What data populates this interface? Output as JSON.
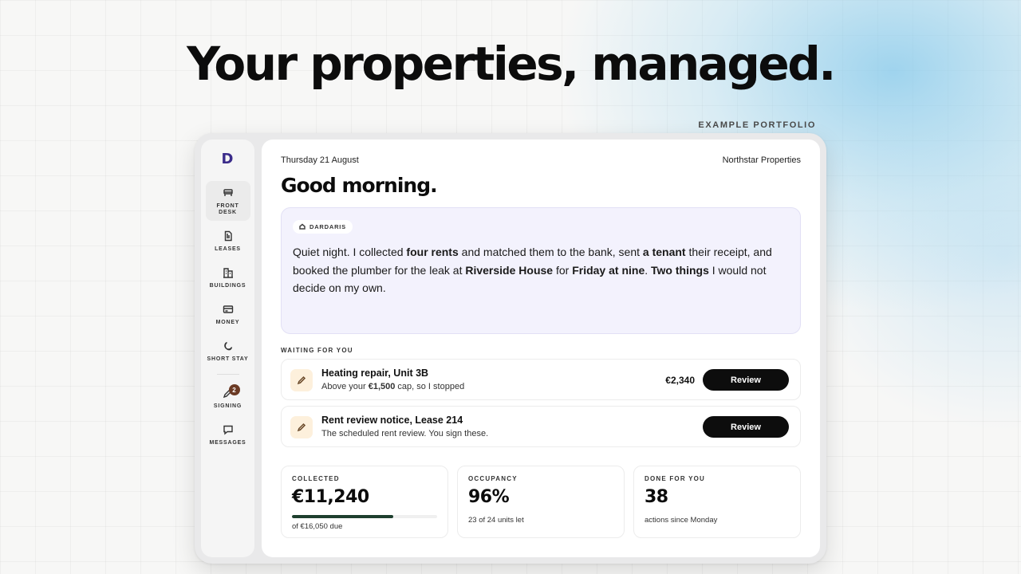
{
  "headline": "Your properties, managed.",
  "example_tag": "EXAMPLE PORTFOLIO",
  "sidebar": {
    "logo": "D",
    "items": [
      {
        "label": "FRONT DESK",
        "icon": "front-desk-icon",
        "active": true
      },
      {
        "label": "LEASES",
        "icon": "document-icon",
        "active": false
      },
      {
        "label": "BUILDINGS",
        "icon": "buildings-icon",
        "active": false
      },
      {
        "label": "MONEY",
        "icon": "card-icon",
        "active": false
      },
      {
        "label": "SHORT STAY",
        "icon": "moon-icon",
        "active": false
      },
      {
        "label": "SIGNING",
        "icon": "pen-icon",
        "active": false,
        "badge": "2"
      },
      {
        "label": "MESSAGES",
        "icon": "chat-icon",
        "active": false
      }
    ]
  },
  "header": {
    "date": "Thursday 21 August",
    "company": "Northstar Properties",
    "greeting": "Good morning."
  },
  "summary": {
    "chip": "DARDARIS",
    "t1": "Quiet night. I collected ",
    "b1": "four rents",
    "t2": " and matched them to the bank, sent ",
    "b2": "a tenant",
    "t3": " their receipt, and booked the plumber for the leak at ",
    "b3": "Riverside House",
    "t4": " for ",
    "b4": "Friday at nine",
    "t5": ". ",
    "b5": "Two things",
    "t6": " I would not decide on my own."
  },
  "waiting": {
    "label": "WAITING FOR YOU",
    "tasks": [
      {
        "title": "Heating repair, Unit 3B",
        "sub_pre": "Above your ",
        "sub_bold": "€1,500",
        "sub_post": " cap, so I stopped",
        "amount": "€2,340",
        "button": "Review"
      },
      {
        "title": "Rent review notice, Lease 214",
        "sub": "The scheduled rent review. You sign these.",
        "button": "Review"
      }
    ]
  },
  "stats": [
    {
      "label": "COLLECTED",
      "value": "€11,240",
      "sub": "of €16,050 due",
      "progress": 0.7
    },
    {
      "label": "OCCUPANCY",
      "value": "96%",
      "sub": "23 of 24 units let"
    },
    {
      "label": "DONE FOR YOU",
      "value": "38",
      "sub": "actions since Monday"
    }
  ],
  "colors": {
    "accent_dark": "#0d0d0d",
    "summary_bg": "#f3f2fd",
    "progress_fill": "#1e3f2e",
    "badge": "#6b3a24",
    "task_icon_bg": "#fdf0dc"
  }
}
